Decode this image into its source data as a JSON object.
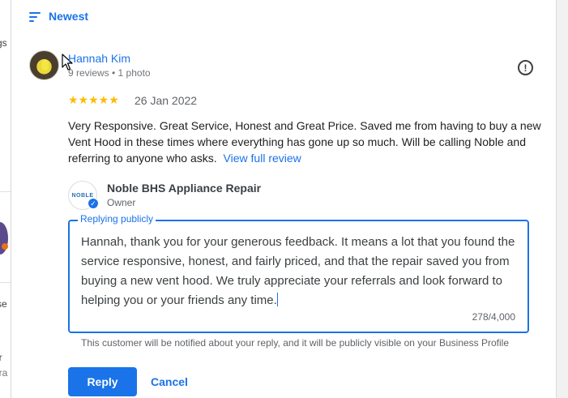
{
  "sort": {
    "label": "Newest",
    "icon": "sort-icon"
  },
  "background_fragments": [
    "gs",
    "se",
    "ir",
    "ira"
  ],
  "review": {
    "reviewer_name": "Hannah Kim",
    "reviewer_meta": "9 reviews • 1 photo",
    "rating": 5,
    "stars": "★★★★★",
    "date": "26 Jan 2022",
    "text": "Very Responsive. Great Service, Honest and Great Price. Saved me from having to buy a new Vent Hood in these times where everything has gone up so much. Will be calling Noble and referring to anyone who asks.",
    "view_full_label": "View full review",
    "flag_icon": "!"
  },
  "owner": {
    "name": "Noble BHS Appliance Repair",
    "role": "Owner",
    "logo_text": "NOBLE"
  },
  "reply": {
    "legend": "Replying publicly",
    "text": "Hannah, thank you for your generous feedback. It means a lot that you found the service responsive, honest, and fairly priced, and that the repair saved you from buying a new vent hood. We truly appreciate your referrals and look forward to helping you or your friends any time.",
    "char_count": "278/4,000",
    "notice": "This customer will be notified about your reply, and it will be publicly visible on your Business Profile"
  },
  "actions": {
    "reply_label": "Reply",
    "cancel_label": "Cancel"
  },
  "colors": {
    "accent": "#1a73e8",
    "star": "#fbbc04",
    "text": "#202124",
    "muted": "#5f6368"
  }
}
